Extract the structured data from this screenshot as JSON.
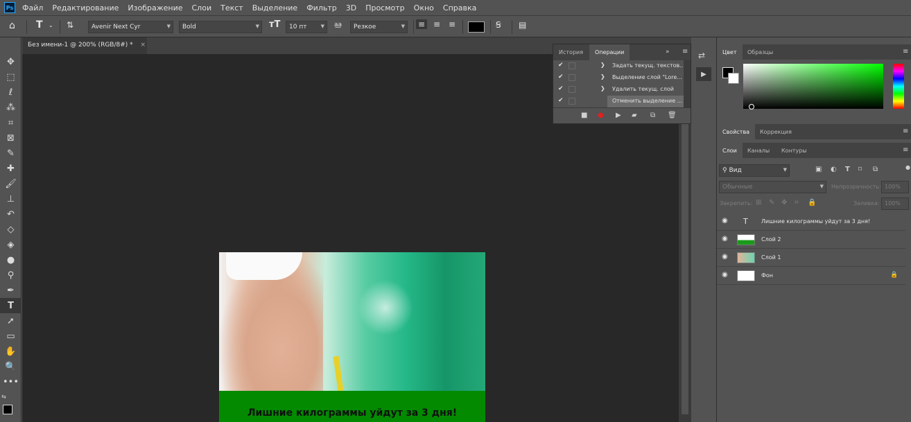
{
  "menu": [
    "Файл",
    "Редактирование",
    "Изображение",
    "Слои",
    "Текст",
    "Выделение",
    "Фильтр",
    "3D",
    "Просмотр",
    "Окно",
    "Справка"
  ],
  "app_logo": "Ps",
  "options": {
    "font_family": "Avenir Next Cyr",
    "font_style": "Bold",
    "font_size": "10 пт",
    "aa_label": "a͟a",
    "antialias": "Резкое",
    "text_color": "#000000"
  },
  "document": {
    "tab_title": "Без имени-1 @ 200% (RGB/8#) *",
    "close": "×",
    "headline": "Лишние килограммы уйдут за 3 дня!"
  },
  "actions_panel": {
    "tabs": [
      "История",
      "Операции"
    ],
    "rows": [
      {
        "check": "✔",
        "label": "Задать текущ. текстов..."
      },
      {
        "check": "✔",
        "label": "Выделение слой \"Lore..."
      },
      {
        "check": "✔",
        "label": "Удалить текущ. слой"
      },
      {
        "check": "✔",
        "label": "Отменить выделение ..."
      }
    ]
  },
  "color_panel": {
    "tabs": [
      "Цвет",
      "Образцы"
    ],
    "foreground": "#000000",
    "background": "#ffffff"
  },
  "properties_panel": {
    "tabs": [
      "Свойства",
      "Коррекция"
    ]
  },
  "layers_panel": {
    "tabs": [
      "Слои",
      "Каналы",
      "Контуры"
    ],
    "filter": "Вид",
    "blend_mode": "Обычные",
    "opacity_label": "Непрозрачность:",
    "opacity_value": "100%",
    "lock_label": "Закрепить:",
    "fill_label": "Заливка:",
    "fill_value": "100%",
    "layers": [
      {
        "name": "Лишние килограммы уйдут за 3 дня!",
        "kind": "text",
        "visible": true
      },
      {
        "name": "Слой 2",
        "kind": "pixel",
        "visible": true
      },
      {
        "name": "Слой 1",
        "kind": "pixel",
        "visible": true
      },
      {
        "name": "Фон",
        "kind": "background",
        "visible": true,
        "locked": true
      }
    ]
  },
  "icons": {
    "eye": "◉",
    "lock": "🔒",
    "chevron": "❯"
  }
}
